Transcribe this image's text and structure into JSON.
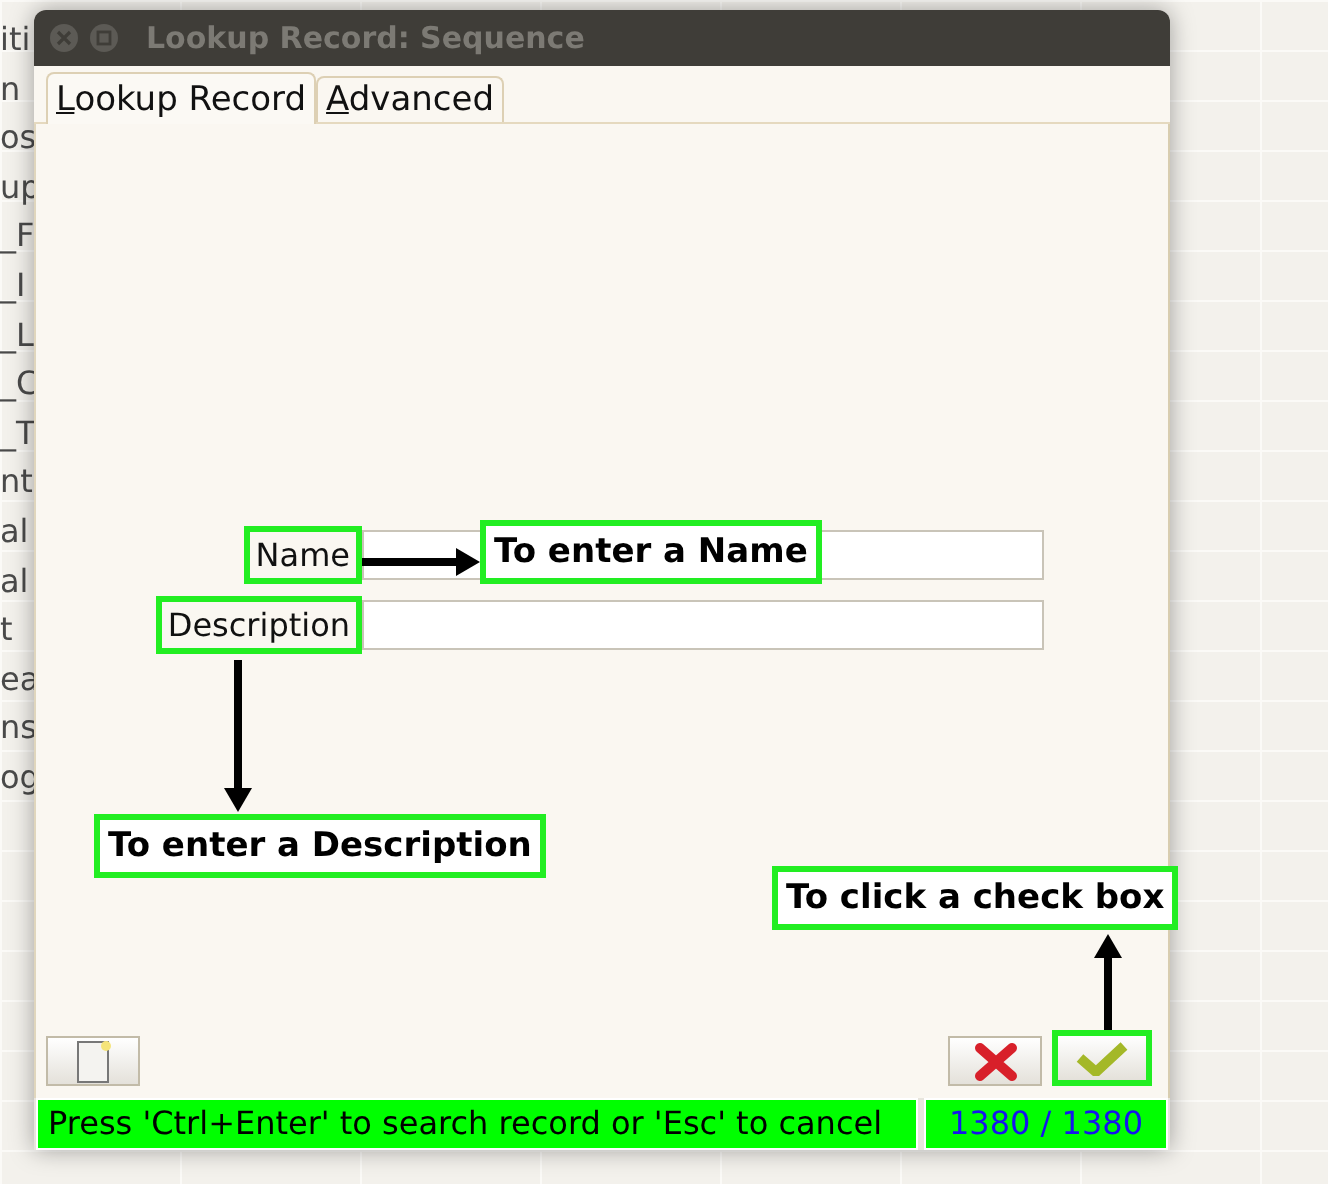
{
  "background_items": [
    "iti",
    "n",
    "os",
    "up",
    "_F",
    "_I",
    "_L",
    "_C",
    "_T",
    "nt",
    "al",
    "al",
    "t",
    "ea",
    "ns",
    "og"
  ],
  "window": {
    "title": "Lookup Record: Sequence"
  },
  "tabs": [
    {
      "label": "Lookup Record",
      "selected": true
    },
    {
      "label": "Advanced",
      "selected": false
    }
  ],
  "fields": [
    {
      "label": "Name"
    },
    {
      "label": "Description"
    }
  ],
  "annotations": [
    {
      "text": "To enter a Name"
    },
    {
      "text": "To enter a Description"
    },
    {
      "text": "To click a check box"
    }
  ],
  "buttons": [
    {
      "kind": "notes"
    },
    {
      "kind": "cancel"
    },
    {
      "kind": "ok"
    }
  ],
  "status_bar": {
    "message": "Press 'Ctrl+Enter' to search record or 'Esc' to cancel",
    "count": "1380 / 1380"
  }
}
